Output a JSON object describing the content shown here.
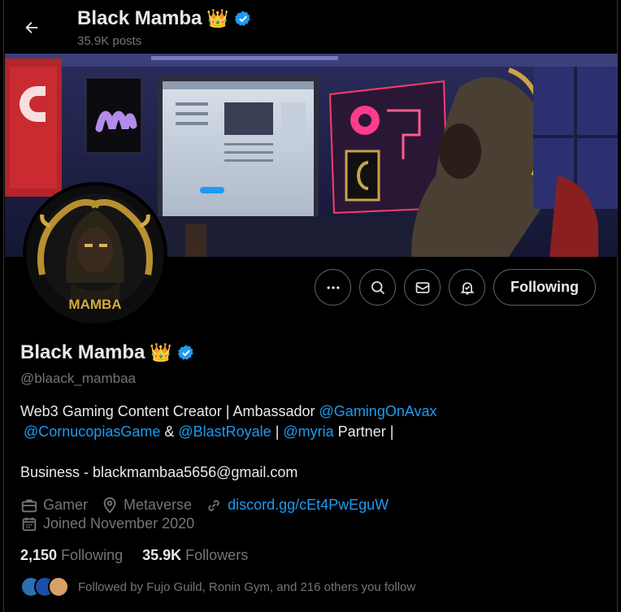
{
  "header": {
    "name": "Black Mamba",
    "crown_emoji": "👑",
    "posts_count": "35.9K posts"
  },
  "banner": {
    "description_icons": [
      "cornucopias-logo",
      "myria-logo",
      "gaming-setup"
    ]
  },
  "avatar": {
    "text": "MAMBA"
  },
  "actions": {
    "more_icon": "more-icon",
    "search_icon": "search-icon",
    "message_icon": "message-icon",
    "notify_icon": "notification-bell-icon",
    "follow_label": "Following"
  },
  "profile": {
    "name": "Black Mamba",
    "crown_emoji": "👑",
    "handle": "@blaack_mambaa",
    "bio": {
      "line1_text": "Web3 Gaming Content Creator | Ambassador ",
      "mention_avax": "@GamingOnAvax",
      "mention_cornucopias": "@CornucopiasGame",
      "amp": " & ",
      "mention_blast": "@BlastRoyale",
      "sep": " | ",
      "mention_myria": "@myria",
      "partner": " Partner |",
      "business": "Business - blackmambaa5656@gmail.com"
    },
    "category": "Gamer",
    "location": "Metaverse",
    "website": "discord.gg/cEt4PwEguW",
    "joined": "Joined November 2020",
    "following_count": "2,150",
    "following_label": "Following",
    "followers_count": "35.9K",
    "followers_label": "Followers",
    "followed_by": "Followed by Fujo Guild, Ronin Gym, and 216 others you follow"
  },
  "colors": {
    "accent": "#1d9bf0",
    "muted": "#71767b",
    "text": "#e7e9ea",
    "background": "#000000"
  }
}
